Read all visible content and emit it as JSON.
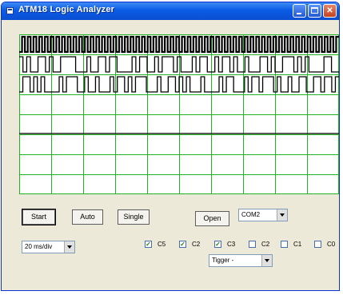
{
  "window": {
    "title": "ATM18 Logic Analyzer"
  },
  "titlebar_buttons": {
    "minimize": "minimize",
    "maximize": "maximize",
    "close": "✕"
  },
  "controls": {
    "start": "Start",
    "auto": "Auto",
    "single": "Single",
    "open": "Open",
    "port": {
      "value": "COM2"
    },
    "timebase": {
      "value": "20 ms/div"
    },
    "trigger": {
      "value": "Tigger -"
    }
  },
  "channels": [
    {
      "label": "C5",
      "checked": true
    },
    {
      "label": "C2",
      "checked": true
    },
    {
      "label": "C3",
      "checked": true
    },
    {
      "label": "C2",
      "checked": false
    },
    {
      "label": "C1",
      "checked": false
    },
    {
      "label": "C0",
      "checked": false
    }
  ],
  "scope": {
    "grid_color": "#21b221",
    "trace_color": "#000000",
    "background": "#ffffff",
    "traces": [
      {
        "name": "trace-0",
        "pattern": "0101010101010101010101010101010101010101010101010101010101010101010101010101010101010101010101010101010101010101"
      },
      {
        "name": "trace-1",
        "pattern": "1010011010011110001001101100001011001011101000101100101101001000110100111010100001100"
      },
      {
        "name": "trace-2",
        "pattern": "0110101000010111001001000101101011100010011010100010000101100010110111010010011001101101"
      }
    ]
  }
}
